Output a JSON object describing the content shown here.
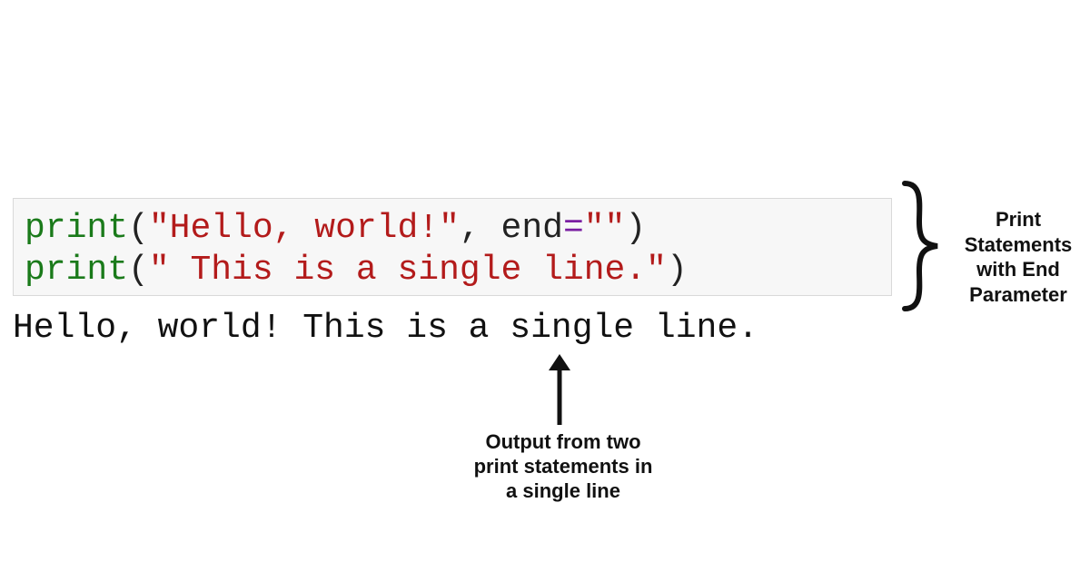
{
  "code": {
    "line1": {
      "func": "print",
      "open": "(",
      "string": "\"Hello, world!\"",
      "comma": ", ",
      "param": "end",
      "op": "=",
      "value": "\"\"",
      "close": ")"
    },
    "line2": {
      "func": "print",
      "open": "(",
      "string": "\" This is a single line.\"",
      "close": ")"
    }
  },
  "output": "Hello, world! This is a single line.",
  "annotations": {
    "right": "Print Statements with End Parameter",
    "bottom": "Output from two print statements in a single line"
  },
  "colors": {
    "func": "#1a7a1a",
    "string": "#b31b1b",
    "operator": "#7a1fa2",
    "code_bg": "#f7f7f7",
    "code_border": "#d9d9d9"
  }
}
